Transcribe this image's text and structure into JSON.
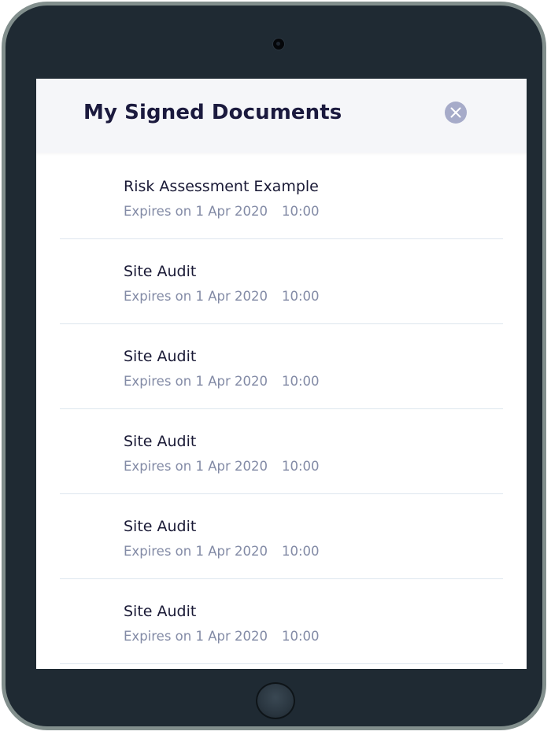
{
  "modal": {
    "title": "My Signed Documents",
    "close_icon": "close-icon"
  },
  "documents": [
    {
      "name": "Risk Assessment Example",
      "expires": "Expires on 1 Apr 2020",
      "time": "10:00"
    },
    {
      "name": "Site Audit",
      "expires": "Expires on 1 Apr 2020",
      "time": "10:00"
    },
    {
      "name": "Site Audit",
      "expires": "Expires on 1 Apr 2020",
      "time": "10:00"
    },
    {
      "name": "Site Audit",
      "expires": "Expires on 1 Apr 2020",
      "time": "10:00"
    },
    {
      "name": "Site Audit",
      "expires": "Expires on 1 Apr 2020",
      "time": "10:00"
    },
    {
      "name": "Site Audit",
      "expires": "Expires on 1 Apr 2020",
      "time": "10:00"
    }
  ],
  "colors": {
    "device_frame": "#1f2a33",
    "device_bezel": "#828f8d",
    "header_background": "#f5f6f9",
    "title_text": "#1b1a3e",
    "close_button": "#a6abc9",
    "meta_text": "#838ba6",
    "divider": "#dde6ee"
  }
}
